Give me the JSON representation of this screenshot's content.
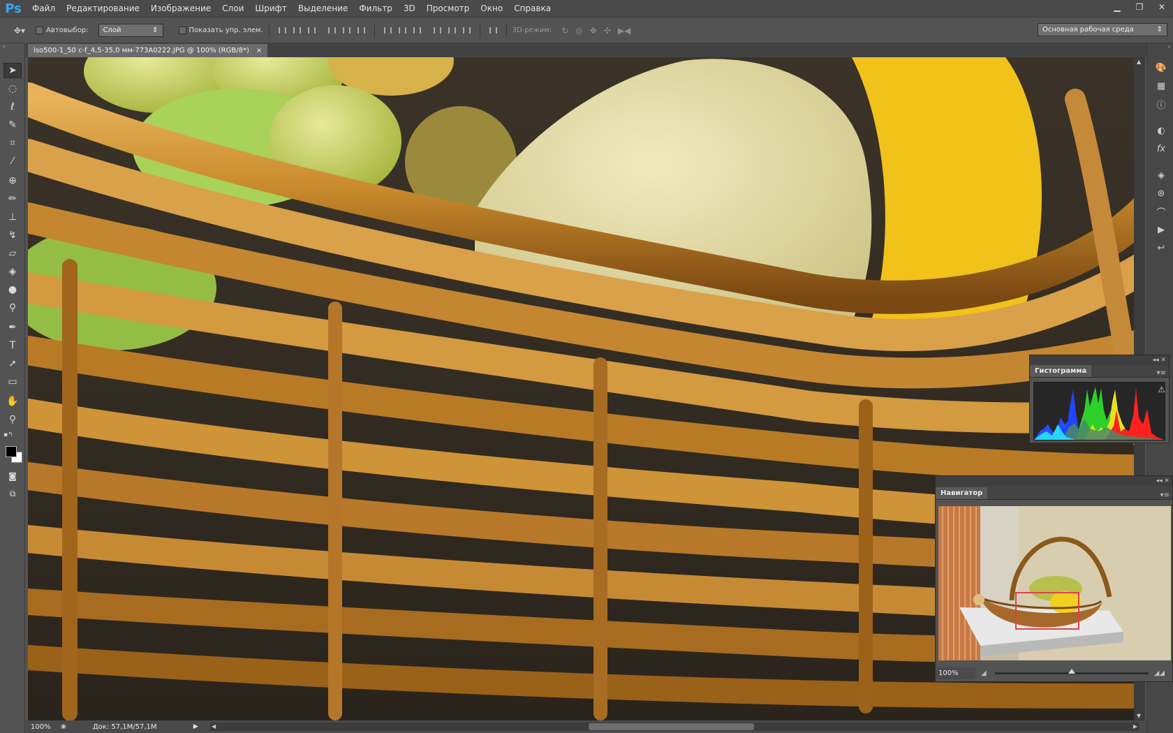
{
  "app": {
    "logo": "Ps",
    "menu": [
      "Файл",
      "Редактирование",
      "Изображение",
      "Слои",
      "Шрифт",
      "Выделение",
      "Фильтр",
      "3D",
      "Просмотр",
      "Окно",
      "Справка"
    ]
  },
  "options": {
    "autoselect_label": "Автовыбор:",
    "autoselect_value": "Слой",
    "show_controls_label": "Показать упр. элем.",
    "mode3d_label": "3D-режим:",
    "workspace_value": "Основная рабочая среда"
  },
  "document": {
    "tab_title": "iso500-1_50 c-f_4,5-35,0 мм-773A0222.JPG @ 100% (RGB/8*)",
    "close_glyph": "×"
  },
  "panels": {
    "histogram": {
      "title": "Гистограмма"
    },
    "navigator": {
      "title": "Навигатор",
      "zoom": "100%",
      "zoom_level": 0.5
    }
  },
  "status": {
    "zoom": "100%",
    "doc_size": "Док: 57,1M/57,1M"
  },
  "icons": {
    "move": "move-tool-icon",
    "marquee": "marquee-icon",
    "lasso": "lasso-icon",
    "quick_select": "quick-select-icon",
    "crop": "crop-icon",
    "eyedropper": "eyedropper-icon",
    "healing": "healing-brush-icon",
    "brush": "brush-icon",
    "stamp": "clone-stamp-icon",
    "history_brush": "history-brush-icon",
    "eraser": "eraser-icon",
    "paint_bucket": "paint-bucket-icon",
    "blur": "blur-icon",
    "dodge": "dodge-icon",
    "pen": "pen-icon",
    "type": "type-icon",
    "path_select": "path-select-icon",
    "rectangle": "rectangle-icon",
    "hand": "hand-icon",
    "zoom": "zoom-icon"
  },
  "colors": {
    "ps_blue": "#31a8ff",
    "ui_dark": "#535353",
    "nav_frame": "#e0404a"
  }
}
